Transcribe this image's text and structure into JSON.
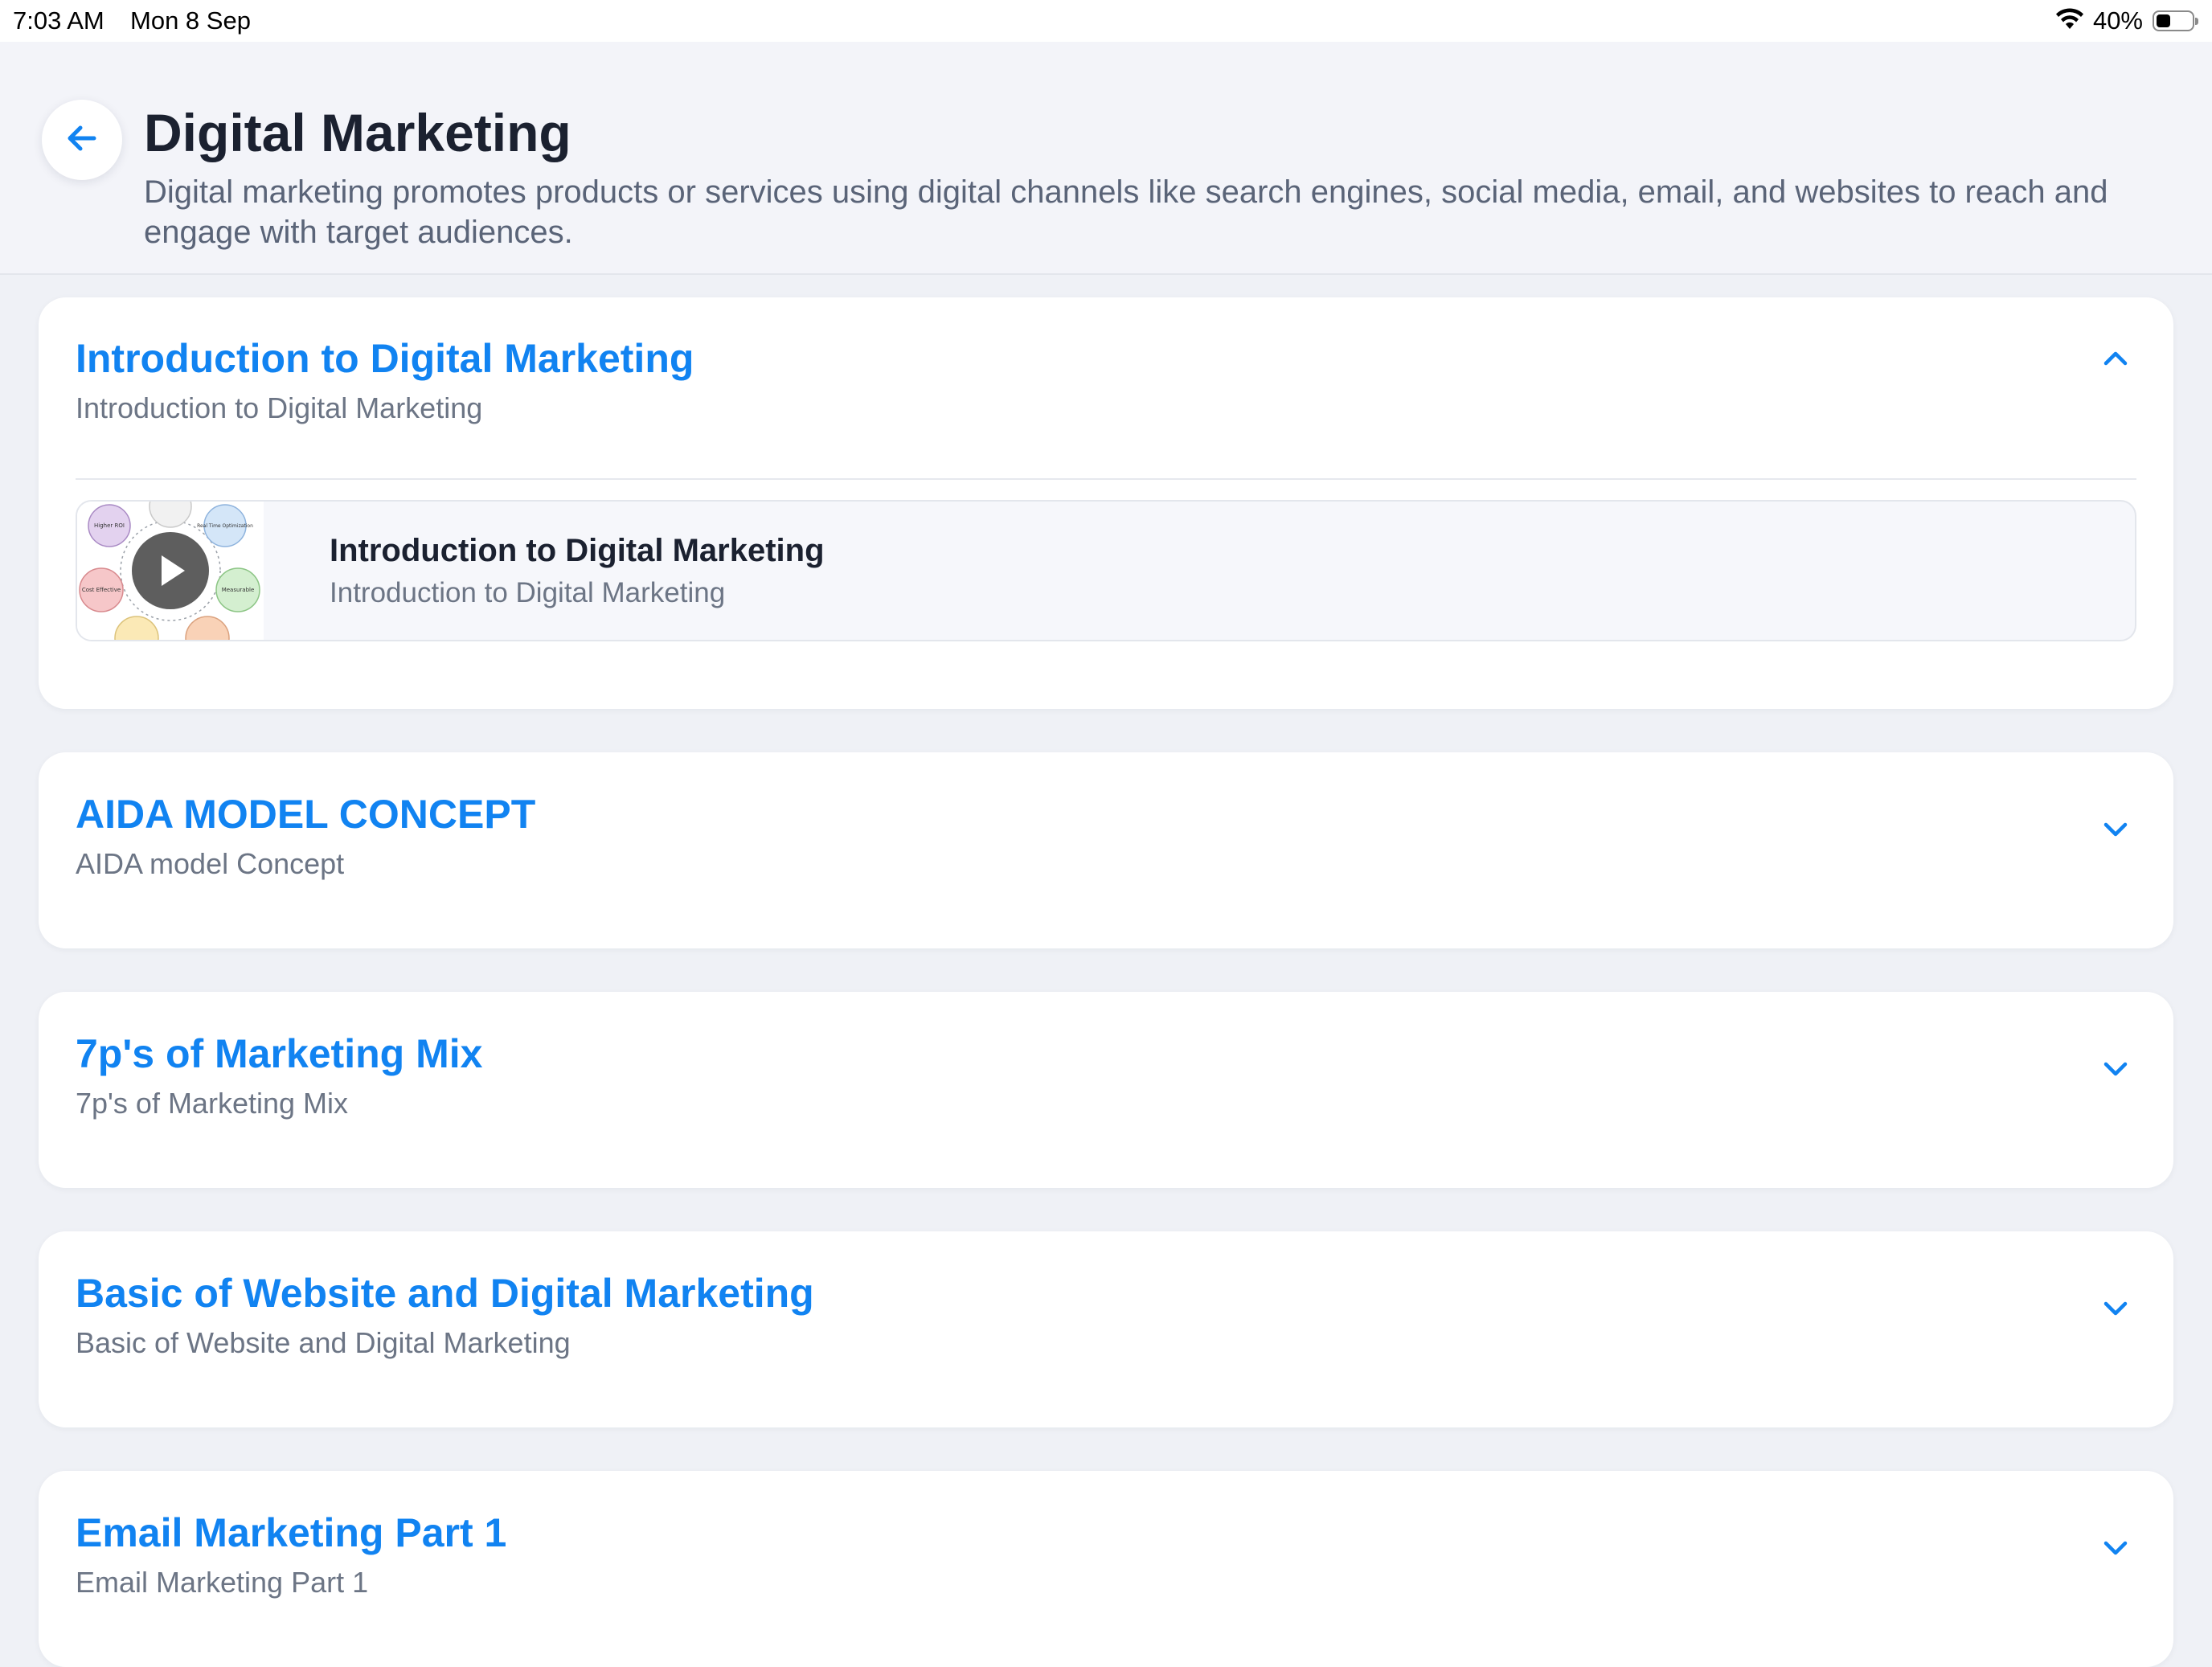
{
  "status_bar": {
    "time": "7:03 AM",
    "date": "Mon 8 Sep",
    "battery_percent": "40%",
    "battery_level": 0.4,
    "icons": [
      "wifi-icon",
      "battery-icon"
    ]
  },
  "header": {
    "back_icon": "arrow-left-icon",
    "title": "Digital Marketing",
    "description": "Digital marketing promotes products or services using digital channels like search engines, social media, email, and websites to reach and engage with target audiences."
  },
  "modules": [
    {
      "title": "Introduction to Digital Marketing",
      "subtitle": "Introduction to Digital Marketing",
      "expanded": true,
      "chevron": "chevron-up-icon",
      "lessons": [
        {
          "title": "Introduction to Digital Marketing",
          "subtitle": "Introduction to Digital Marketing",
          "thumbnail_labels": [
            "Higher ROI",
            "Real Time Optimization",
            "Cost Effective",
            "Measurable"
          ],
          "play_icon": "play-icon"
        }
      ]
    },
    {
      "title": "AIDA MODEL CONCEPT",
      "subtitle": "AIDA model Concept",
      "expanded": false,
      "chevron": "chevron-down-icon"
    },
    {
      "title": "7p's of Marketing Mix",
      "subtitle": "7p's of Marketing Mix",
      "expanded": false,
      "chevron": "chevron-down-icon"
    },
    {
      "title": "Basic of Website and Digital Marketing",
      "subtitle": "Basic of Website and Digital Marketing",
      "expanded": false,
      "chevron": "chevron-down-icon"
    },
    {
      "title": "Email Marketing Part 1",
      "subtitle": "Email Marketing Part 1",
      "expanded": false,
      "chevron": "chevron-down-icon"
    }
  ],
  "colors": {
    "accent": "#1183f1",
    "background": "#eff1f6",
    "title_text": "#1b2130",
    "muted_text": "#6c7585"
  }
}
